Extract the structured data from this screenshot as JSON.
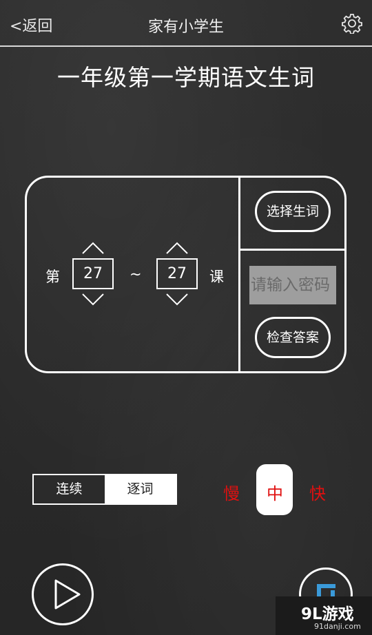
{
  "header": {
    "back_label": "<返回",
    "title": "家有小学生"
  },
  "page_title": "一年级第一学期语文生词",
  "range": {
    "prefix": "第",
    "from_value": "27",
    "separator": "~",
    "to_value": "27",
    "suffix": "课"
  },
  "buttons": {
    "select_words": "选择生词",
    "check_answer": "检查答案"
  },
  "password": {
    "placeholder": "请输入密码"
  },
  "mode": {
    "continuous": "连续",
    "word_by_word": "逐词"
  },
  "speed": {
    "slow": "慢",
    "medium": "中",
    "fast": "快",
    "selected": "中"
  },
  "watermark": {
    "logo": "9L游戏",
    "url": "91danji.com"
  },
  "colors": {
    "speed_text": "#e01010",
    "repeat_icon": "#3a9ad9",
    "password_bg": "#9e9e9e"
  }
}
